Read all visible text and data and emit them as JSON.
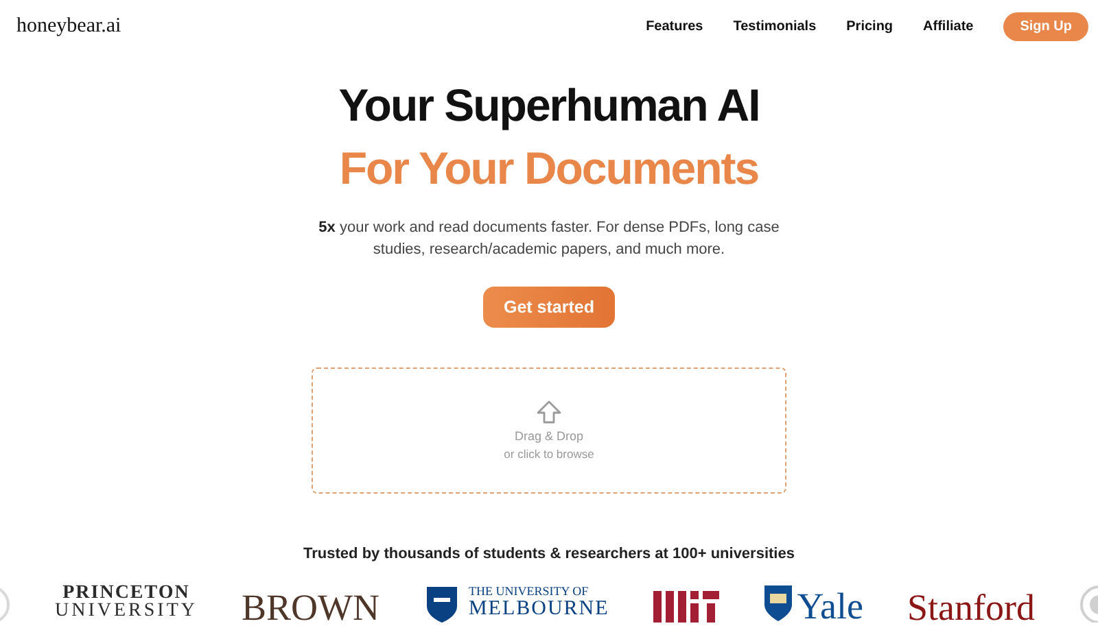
{
  "nav": {
    "logo": "honeybear.ai",
    "links": [
      "Features",
      "Testimonials",
      "Pricing",
      "Affiliate"
    ],
    "cta": "Sign Up"
  },
  "hero": {
    "title": "Your Superhuman AI",
    "subtitle": "For Your Documents",
    "text": "**5x** your work and read documents faster. For dense PDFs, long case studies, research/academic papers, and much more.",
    "button": "Get started"
  },
  "upload": {
    "title": "Drag & Drop",
    "hint": "or click to browse"
  },
  "trusted": "Trusted by thousands of students & researchers at 100+ universities",
  "logos": [
    {
      "kind": "seal",
      "color": "#d9d9d9"
    },
    {
      "kind": "stack",
      "lines": [
        "PRINCETON",
        "UNIVERSITY"
      ],
      "color": "#2b2b2b"
    },
    {
      "kind": "word",
      "text": "BROWN",
      "color": "#4e3629"
    },
    {
      "kind": "crest",
      "lines": [
        "THE UNIVERSITY OF",
        "MELBOURNE"
      ],
      "color": "#094183"
    },
    {
      "kind": "bars",
      "color": "#a31f34"
    },
    {
      "kind": "crestword",
      "text": "Yale",
      "color": "#0f4d92"
    },
    {
      "kind": "word",
      "text": "Stanford",
      "color": "#8c1515"
    },
    {
      "kind": "seal",
      "color": "#d0d0d0"
    }
  ]
}
